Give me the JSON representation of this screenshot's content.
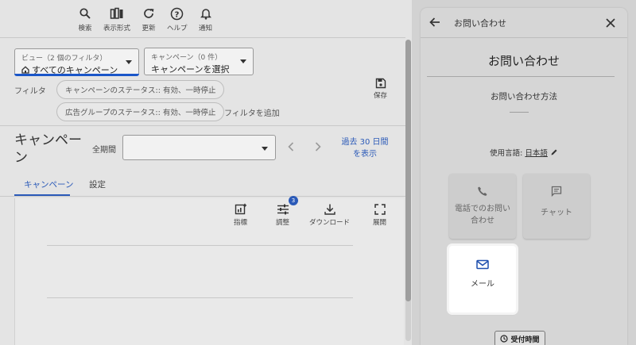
{
  "toolbar": {
    "items": [
      {
        "label": "検索",
        "icon": "search-icon"
      },
      {
        "label": "表示形式",
        "icon": "view-format-icon"
      },
      {
        "label": "更新",
        "icon": "refresh-icon"
      },
      {
        "label": "ヘルプ",
        "icon": "help-icon"
      },
      {
        "label": "通知",
        "icon": "bell-icon"
      }
    ]
  },
  "view_select": {
    "top": "ビュー（2 個のフィルタ）",
    "value": "すべてのキャンペーン"
  },
  "campaign_select": {
    "top": "キャンペーン（0 件）",
    "value": "キャンペーンを選択"
  },
  "filters": {
    "label": "フィルタ",
    "chips": [
      "キャンペーンのステータス:: 有効、一時停止",
      "広告グループのステータス:: 有効、一時停止"
    ],
    "add": "フィルタを追加"
  },
  "save": {
    "label": "保存"
  },
  "page": {
    "title": "キャンペーン",
    "period_label": "全期間",
    "period_value": "",
    "last30": "過去 30 日間を表示"
  },
  "tabs": [
    {
      "label": "キャンペーン",
      "active": true
    },
    {
      "label": "設定",
      "active": false
    }
  ],
  "table_tools": [
    {
      "label": "指標",
      "icon": "metrics-icon"
    },
    {
      "label": "調整",
      "icon": "adjust-icon",
      "badge": "3"
    },
    {
      "label": "ダウンロード",
      "icon": "download-icon"
    },
    {
      "label": "展開",
      "icon": "expand-icon"
    }
  ],
  "help_panel": {
    "header_title": "お問い合わせ",
    "title": "お問い合わせ",
    "method_label": "お問い合わせ方法",
    "lang_label": "使用言語:",
    "lang_value": "日本語",
    "cards": [
      {
        "label": "電話でのお問い合わせ",
        "icon": "phone-icon"
      },
      {
        "label": "チャット",
        "icon": "chat-icon"
      },
      {
        "label": "メール",
        "icon": "mail-icon"
      }
    ],
    "hours_button": "受付時間"
  },
  "colors": {
    "accent": "#2b5ab8",
    "overlay": "#d6d6d6"
  }
}
